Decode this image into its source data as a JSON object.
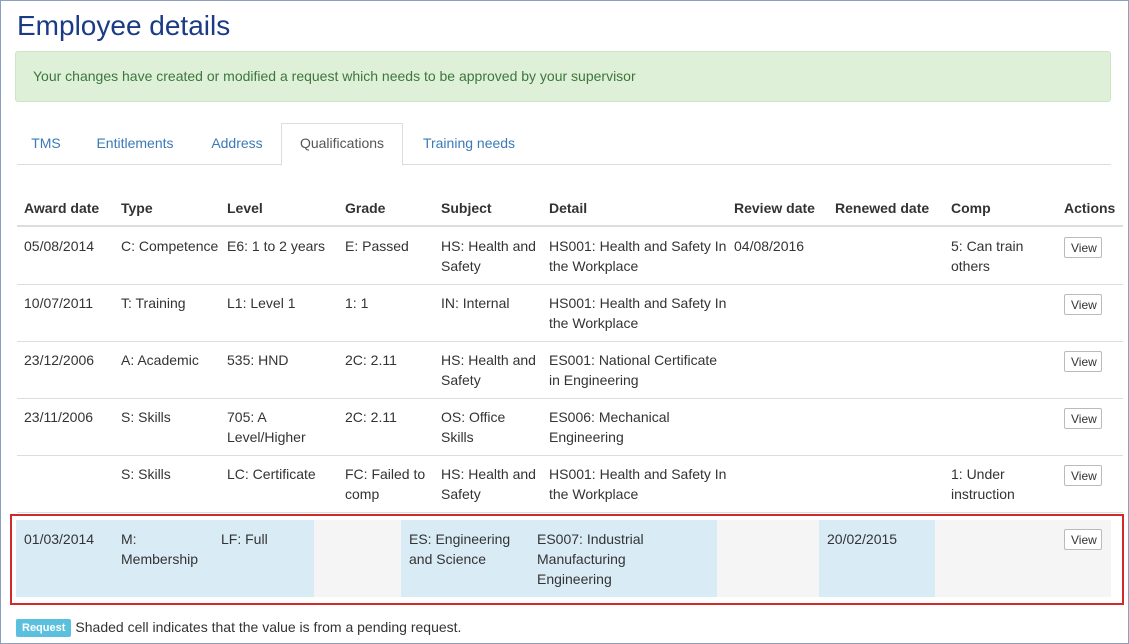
{
  "page": {
    "title": "Employee details",
    "alert": "Your changes have created or modified a request which needs to be approved by your supervisor"
  },
  "tabs": [
    {
      "label": "TMS",
      "active": false
    },
    {
      "label": "Entitlements",
      "active": false
    },
    {
      "label": "Address",
      "active": false
    },
    {
      "label": "Qualifications",
      "active": true
    },
    {
      "label": "Training needs",
      "active": false
    }
  ],
  "table": {
    "headers": [
      "Award date",
      "Type",
      "Level",
      "Grade",
      "Subject",
      "Detail",
      "Review date",
      "Renewed date",
      "Comp",
      "Actions"
    ],
    "view_label": "View",
    "rows": [
      {
        "award": "05/08/2014",
        "type": "C: Competence",
        "level": "E6: 1 to 2 years",
        "grade": "E: Passed",
        "subject": "HS: Health and Safety",
        "detail": "HS001: Health and Safety In the Workplace",
        "review": "04/08/2016",
        "renewed": "",
        "comp": "5: Can train others"
      },
      {
        "award": "10/07/2011",
        "type": "T: Training",
        "level": "L1: Level 1",
        "grade": "1: 1",
        "subject": "IN: Internal",
        "detail": "HS001: Health and Safety In the Workplace",
        "review": "",
        "renewed": "",
        "comp": ""
      },
      {
        "award": "23/12/2006",
        "type": "A: Academic",
        "level": "535: HND",
        "grade": "2C: 2.11",
        "subject": "HS: Health and Safety",
        "detail": "ES001: National Certificate in Engineering",
        "review": "",
        "renewed": "",
        "comp": ""
      },
      {
        "award": "23/11/2006",
        "type": "S: Skills",
        "level": "705: A Level/Higher",
        "grade": "2C: 2.11",
        "subject": "OS: Office Skills",
        "detail": "ES006: Mechanical Engineering",
        "review": "",
        "renewed": "",
        "comp": ""
      },
      {
        "award": "",
        "type": "S: Skills",
        "level": "LC: Certificate",
        "grade": "FC: Failed to comp",
        "subject": "HS: Health and Safety",
        "detail": "HS001: Health and Safety In the Workplace",
        "review": "",
        "renewed": "",
        "comp": "1: Under instruction"
      }
    ],
    "pending_row": {
      "award": "01/03/2014",
      "type": "M: Membership",
      "level": "LF: Full",
      "grade": "",
      "subject": "ES: Engineering and Science",
      "detail": "ES007: Industrial Manufacturing Engineering",
      "review": "",
      "renewed": "20/02/2015",
      "comp": ""
    }
  },
  "legend": {
    "badge": "Request",
    "text": "Shaded cell indicates that the value is from a pending request."
  },
  "colors": {
    "title": "#1b3b86",
    "alert_bg": "#dff0d8",
    "alert_text": "#3c763d",
    "link": "#3a7ab8",
    "pending_shade": "#d9ecf6",
    "pending_outline": "#d12a2a",
    "badge": "#5bc0de"
  }
}
